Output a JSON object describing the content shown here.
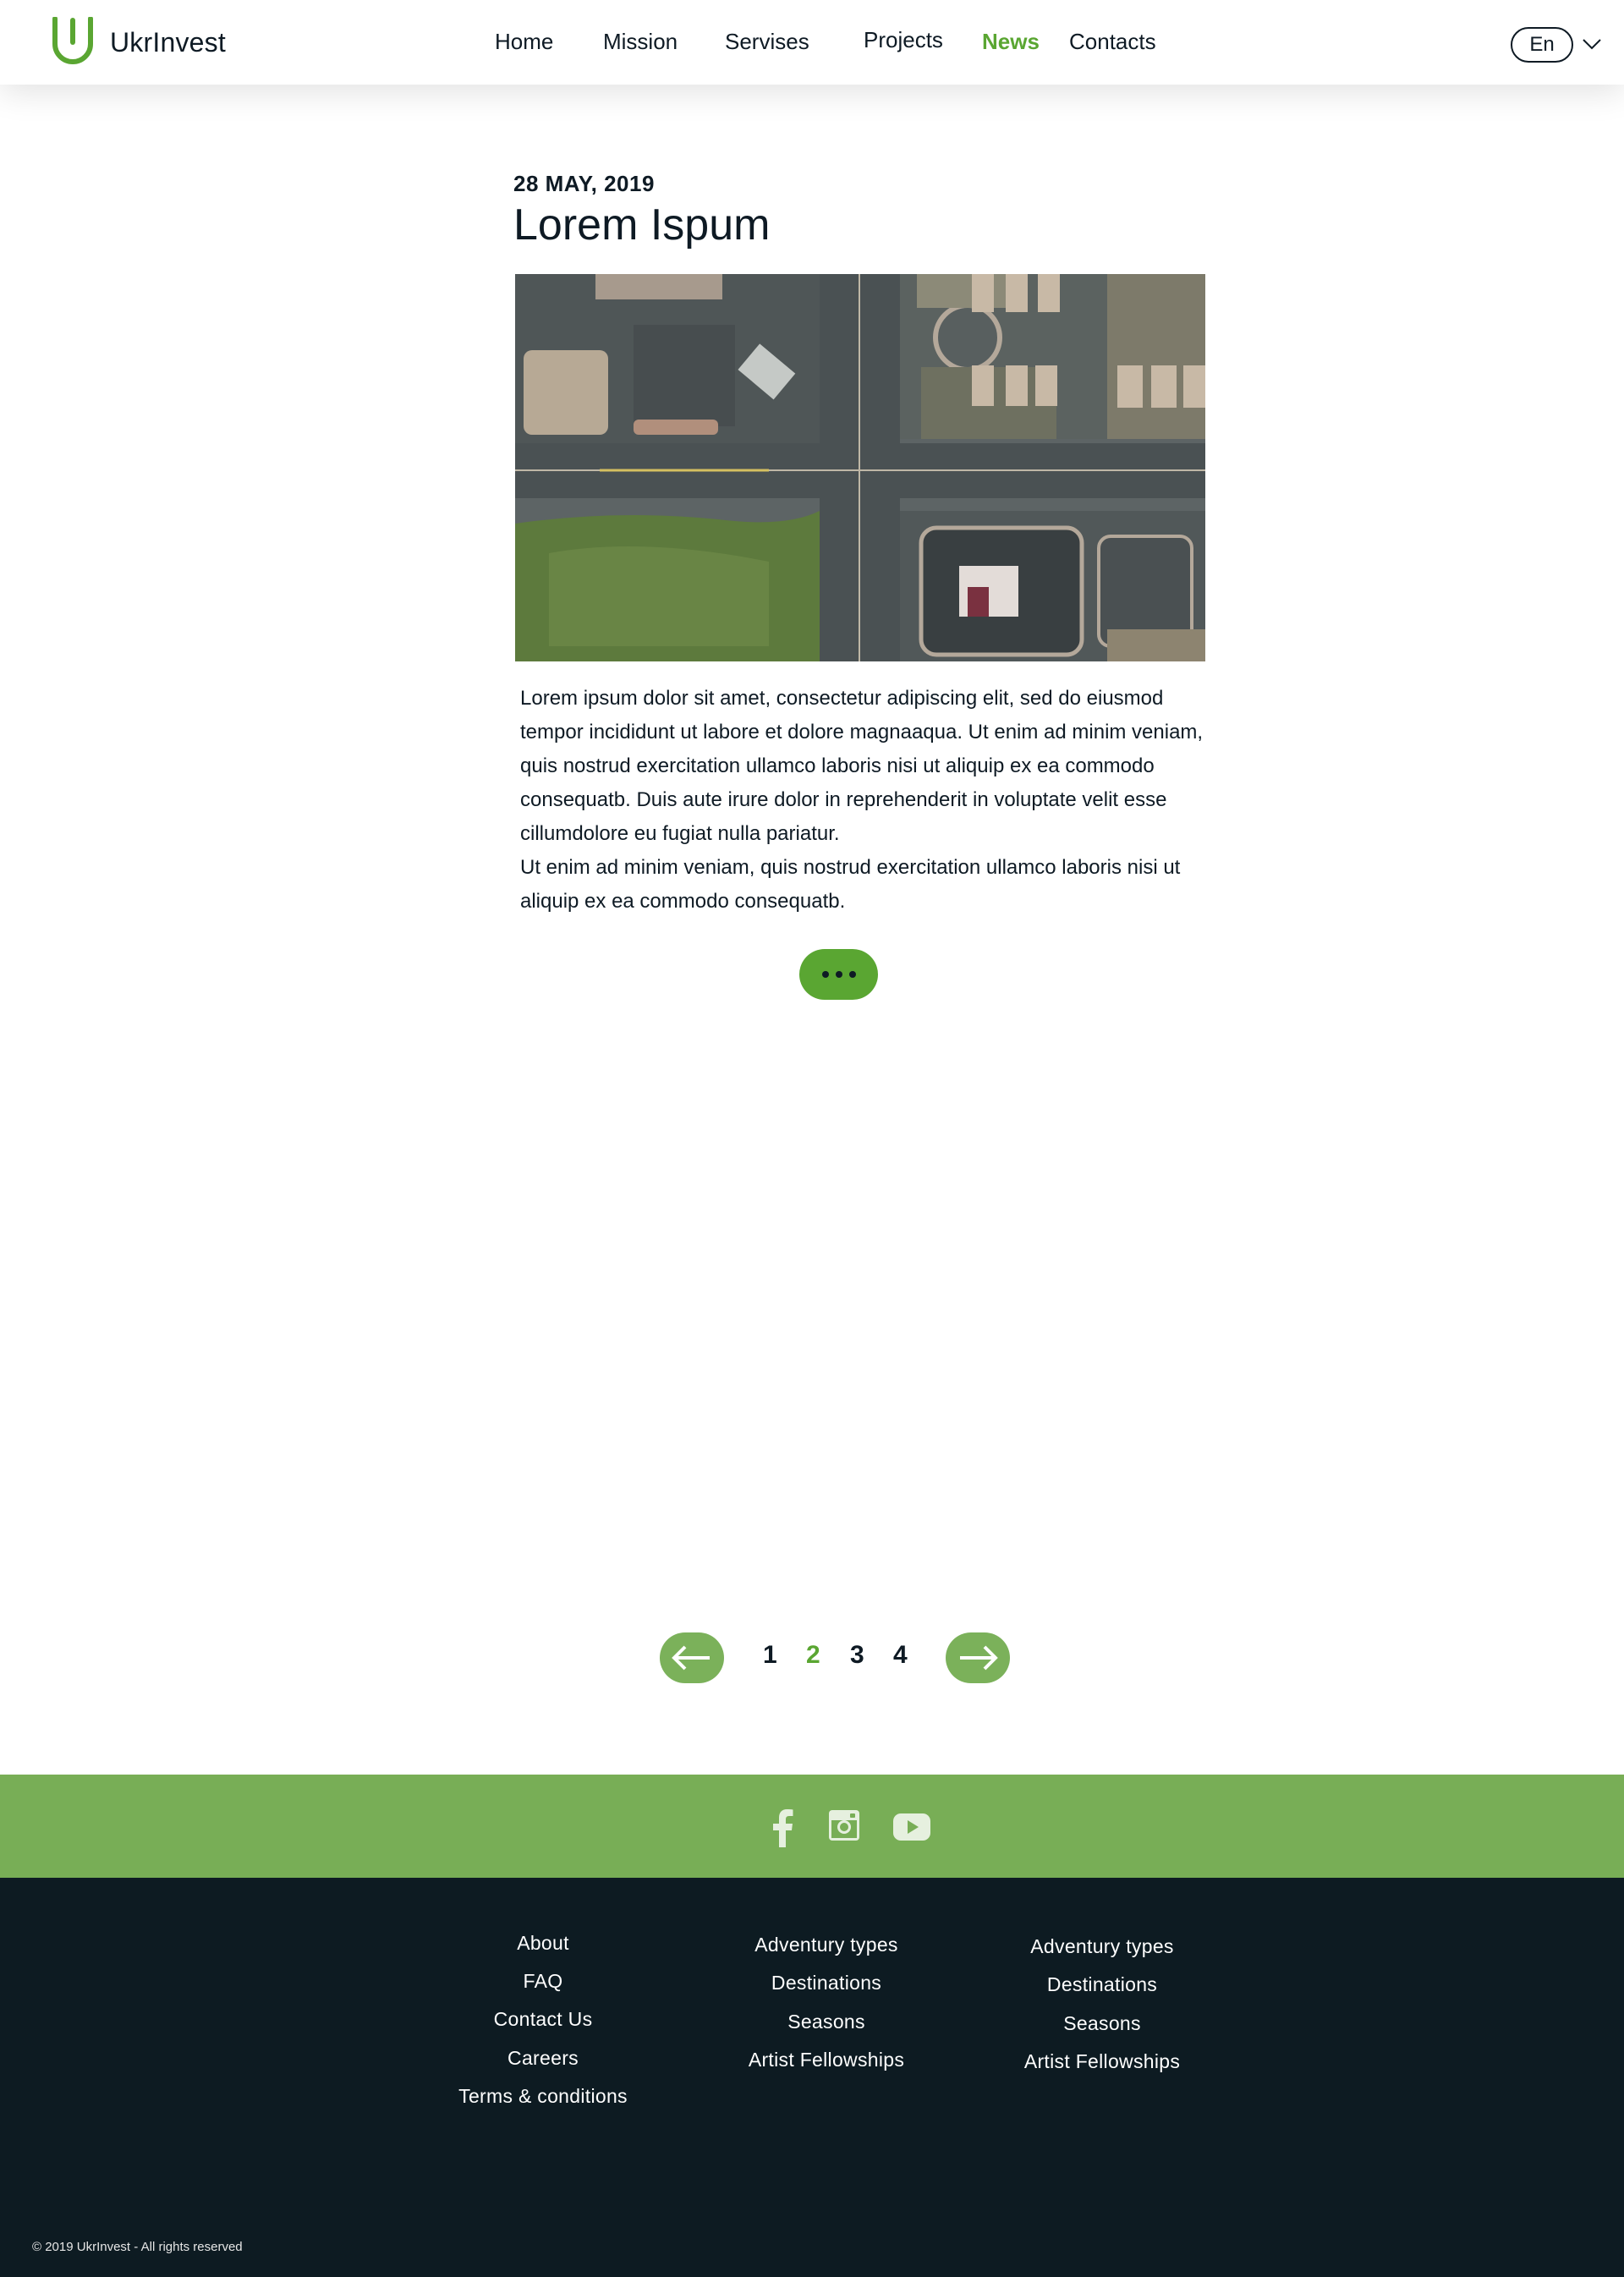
{
  "header": {
    "brand": "UkrInvest",
    "nav": [
      "Home",
      "Mission",
      "Servises",
      "Projects",
      "News",
      "Contacts"
    ],
    "active_nav": "News",
    "language": "En"
  },
  "article": {
    "date": "28 MAY, 2019",
    "title": "Lorem Ispum",
    "paragraphs": [
      "Lorem ipsum  dolor  sit amet, consectetur  adipiscing elit, sed do eiusmod tempor incididunt ut labore et dolore magnaaqua. Ut enim  ad  minim veniam, quis  nostrud  exercitation  ullamco laboris nisi  ut aliquip ex ea commodo consequatb. Duis aute irure dolor in reprehenderit in voluptate velit esse cillumdolore eu fugiat nulla pariatur.",
      "Ut enim  ad  minim veniam, quis  nostrud  exercitation  ullamco laboris nisi ut aliquip ex ea  commodo consequatb."
    ],
    "image_icon": "aerial-city-photo"
  },
  "pagination": {
    "pages": [
      "1",
      "2",
      "3",
      "4"
    ],
    "current": "2",
    "prev_icon": "arrow-left-icon",
    "next_icon": "arrow-right-icon"
  },
  "social": {
    "icons": [
      "facebook-icon",
      "instagram-icon",
      "youtube-icon"
    ]
  },
  "footer": {
    "col1": [
      "About",
      "FAQ",
      "Contact Us",
      "Careers",
      "Terms & conditions"
    ],
    "col2": [
      "Adventury types",
      "Destinations",
      "Seasons",
      "Artist Fellowships"
    ],
    "col3": [
      "Adventury types",
      "Destinations",
      "Seasons",
      "Artist Fellowships"
    ],
    "copyright": "© 2019 UkrInvest - All rights reserved"
  },
  "colors": {
    "brand_green": "#5aa632",
    "social_bar": "#78ae56",
    "footer_bg": "#0d1b22",
    "text_dark": "#0e1a24"
  }
}
